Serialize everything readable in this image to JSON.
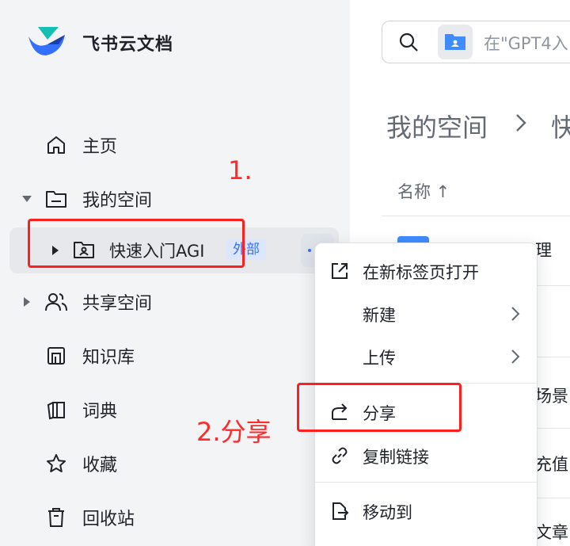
{
  "app": {
    "title": "飞书云文档"
  },
  "sidebar": {
    "items": [
      {
        "label": "主页",
        "icon": "home-icon"
      },
      {
        "label": "我的空间",
        "icon": "folder-icon"
      },
      {
        "label": "快速入门AGI",
        "icon": "shared-folder-icon",
        "badge": "外部"
      },
      {
        "label": "共享空间",
        "icon": "people-icon"
      },
      {
        "label": "知识库",
        "icon": "wiki-icon"
      },
      {
        "label": "词典",
        "icon": "dictionary-icon"
      },
      {
        "label": "收藏",
        "icon": "star-icon"
      },
      {
        "label": "回收站",
        "icon": "trash-icon"
      }
    ]
  },
  "search": {
    "placeholder": "在\"GPT4入"
  },
  "main": {
    "breadcrumb": {
      "root": "我的空间",
      "current": "快"
    },
    "columns": {
      "name": "名称 ↑"
    },
    "row_fragments": [
      "理",
      "场景",
      "充值",
      "文章"
    ]
  },
  "context_menu": {
    "items": [
      {
        "label": "在新标签页打开",
        "icon": "open-new-tab-icon"
      },
      {
        "label": "新建",
        "icon": "",
        "submenu": true
      },
      {
        "label": "上传",
        "icon": "",
        "submenu": true
      },
      {
        "label": "分享",
        "icon": "share-icon"
      },
      {
        "label": "复制链接",
        "icon": "link-icon"
      },
      {
        "label": "移动到",
        "icon": "move-to-icon"
      }
    ]
  },
  "annotations": {
    "step1": "1.",
    "step2": "2.分享"
  },
  "colors": {
    "accent": "#3370ff",
    "annotation": "#ff1f1f",
    "sidebar_bg": "#f3f4f6"
  }
}
